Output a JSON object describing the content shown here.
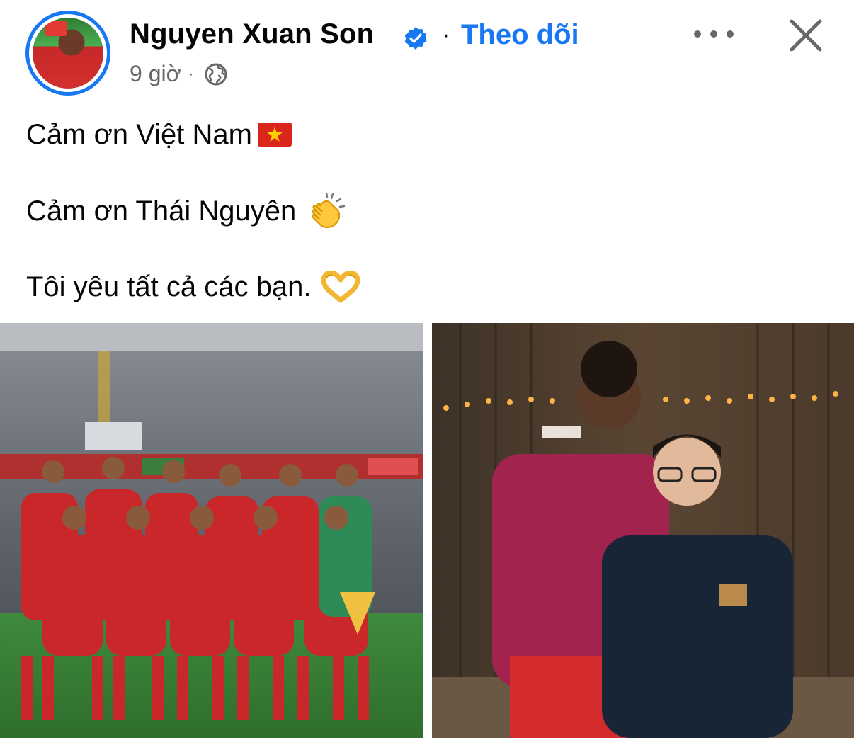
{
  "author": {
    "name": "Nguyen Xuan Son",
    "verified": true,
    "verified_icon": "verified-badge-icon",
    "follow_label": "Theo dõi",
    "separator": "·"
  },
  "meta": {
    "time": "9 giờ",
    "separator": "·",
    "audience_icon": "globe-icon"
  },
  "actions": {
    "more_icon": "more-options-icon",
    "close_icon": "close-icon"
  },
  "post": {
    "line1": "Cảm ơn Việt Nam",
    "line1_emoji": "vietnam-flag-icon",
    "line2": "Cảm ơn Thái Nguyên",
    "line2_emoji": "clapping-hands-icon",
    "line3": "Tôi yêu tất cả các bạn.",
    "line3_emoji": "heart-hands-icon"
  },
  "photos": [
    {
      "name": "team-photo"
    },
    {
      "name": "player-with-fan-photo"
    }
  ],
  "colors": {
    "accent": "#1877f2",
    "secondary_text": "#65676b",
    "primary_text": "#050505"
  }
}
